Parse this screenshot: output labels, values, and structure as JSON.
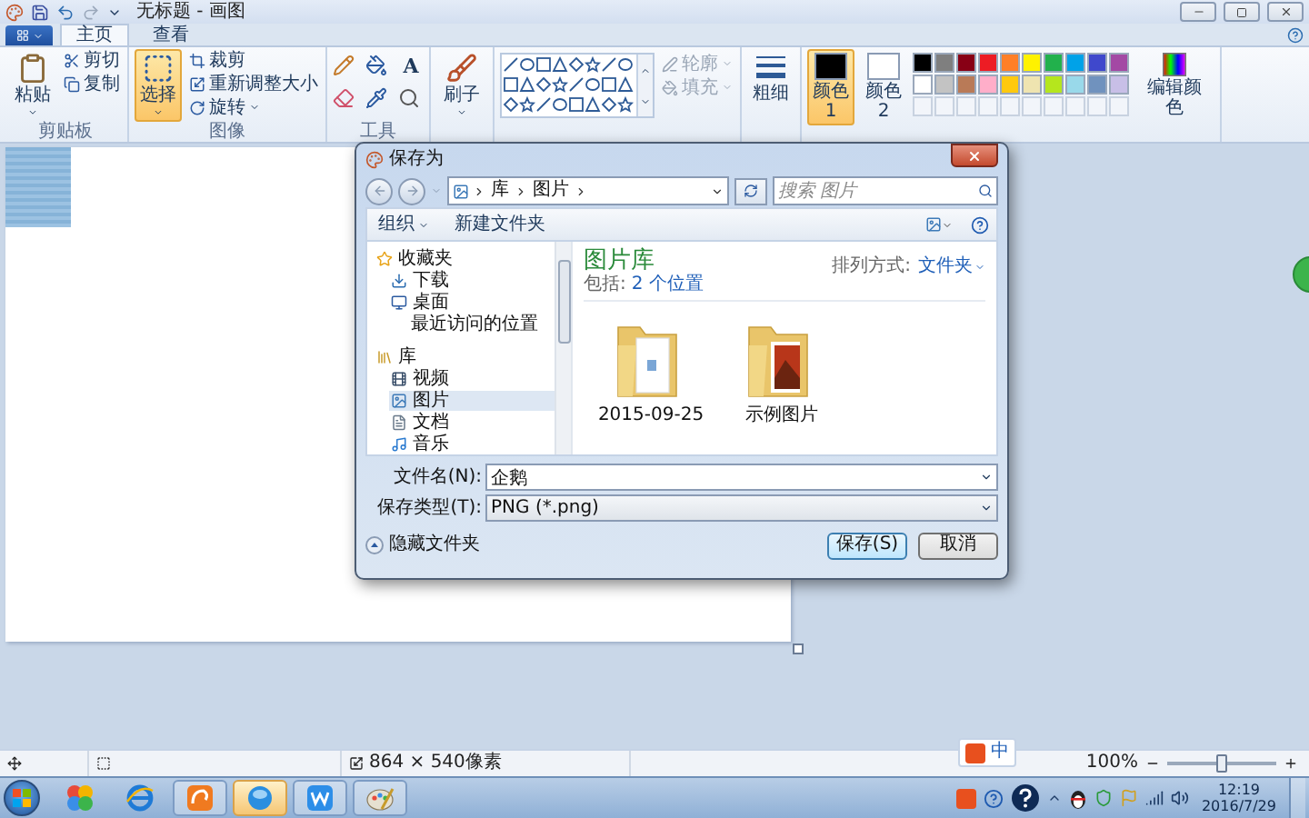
{
  "window": {
    "title": "无标题 - 画图"
  },
  "ribbon": {
    "tabs": [
      {
        "label": "主页",
        "selected": true
      },
      {
        "label": "查看",
        "selected": false
      }
    ],
    "clipboard": {
      "label": "剪贴板",
      "paste": "粘贴",
      "cut": "剪切",
      "copy": "复制"
    },
    "image": {
      "label": "图像",
      "select": {
        "label": "选择",
        "selected": true
      },
      "crop": "裁剪",
      "resize": "重新调整大小",
      "rotate": "旋转"
    },
    "tools": {
      "label": "工具",
      "text": "A"
    },
    "brushes": "刷子",
    "outline": {
      "label": "轮廓",
      "disabled": true
    },
    "fill": {
      "label": "填充",
      "disabled": true
    },
    "size": "粗细",
    "colors": [
      {
        "label": "颜色 1",
        "color": "#000000",
        "selected": true
      },
      {
        "label": "颜色 2",
        "color": "#ffffff",
        "selected": false
      }
    ],
    "palette": [
      {
        "color": "#000000"
      },
      {
        "color": "#7f7f7f"
      },
      {
        "color": "#880015"
      },
      {
        "color": "#ed1c24"
      },
      {
        "color": "#ff7f27"
      },
      {
        "color": "#fff200"
      },
      {
        "color": "#22b14c"
      },
      {
        "color": "#00a2e8"
      },
      {
        "color": "#3f48cc"
      },
      {
        "color": "#a349a4"
      },
      {
        "color": "#ffffff"
      },
      {
        "color": "#c3c3c3"
      },
      {
        "color": "#b97a57"
      },
      {
        "color": "#ffaec9"
      },
      {
        "color": "#ffc90e"
      },
      {
        "color": "#efe4b0"
      },
      {
        "color": "#b5e61d"
      },
      {
        "color": "#99d9ea"
      },
      {
        "color": "#7092be"
      },
      {
        "color": "#c8bfe7"
      }
    ],
    "edit_colors": "编辑颜色"
  },
  "dialog": {
    "title": "保存为",
    "address": [
      "库",
      "图片"
    ],
    "search_placeholder": "搜索 图片",
    "toolbar": {
      "organize": "组织",
      "new_folder": "新建文件夹"
    },
    "nav": [
      {
        "label": "收藏夹",
        "kind": "star",
        "selected": false,
        "children": [
          {
            "label": "下载",
            "kind": "download",
            "selected": false
          },
          {
            "label": "桌面",
            "kind": "desktop",
            "selected": false
          },
          {
            "label": "最近访问的位置",
            "kind": "recent",
            "selected": false
          }
        ]
      },
      {
        "label": "库",
        "kind": "library",
        "selected": false,
        "children": [
          {
            "label": "视频",
            "kind": "video",
            "selected": false
          },
          {
            "label": "图片",
            "kind": "pictures",
            "selected": true
          },
          {
            "label": "文档",
            "kind": "documents",
            "selected": false
          },
          {
            "label": "音乐",
            "kind": "music",
            "selected": false
          }
        ]
      }
    ],
    "library": {
      "title": "图片库",
      "includes_label": "包括:",
      "includes_link": "2 个位置",
      "arrange_label": "排列方式:",
      "arrange_value": "文件夹"
    },
    "items": [
      {
        "name": "2015-09-25",
        "kind": "document"
      },
      {
        "name": "示例图片",
        "kind": "photo"
      }
    ],
    "file_name": {
      "label": "文件名(N):",
      "value": "企鹅"
    },
    "file_type": {
      "label": "保存类型(T):",
      "value": "PNG (*.png)"
    },
    "hide_folders": "隐藏文件夹",
    "buttons": [
      {
        "label": "保存(S)",
        "default": true
      },
      {
        "label": "取消",
        "default": false
      }
    ]
  },
  "status_bar": {
    "size": "864 × 540像素",
    "zoom": "100%",
    "zoom_slider": {
      "level": 0.5
    }
  },
  "ime": {
    "mode": "中"
  },
  "taskbar": {
    "apps": [
      {
        "kind": "pinwheel",
        "running": false,
        "selected": false
      },
      {
        "kind": "browser",
        "running": false,
        "selected": false
      },
      {
        "kind": "uc",
        "running": true,
        "selected": false
      },
      {
        "kind": "circle",
        "running": true,
        "selected": true
      },
      {
        "kind": "writer",
        "running": true,
        "selected": false
      },
      {
        "kind": "paint",
        "running": true,
        "selected": false
      }
    ],
    "time": "12:19",
    "date": "2016/7/29"
  }
}
